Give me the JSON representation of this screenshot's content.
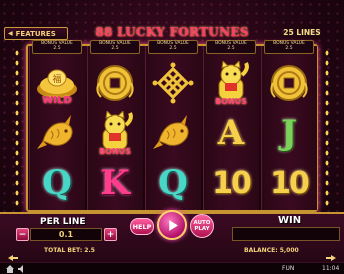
{
  "header": {
    "features_label": "FEATURES",
    "title": "88 LUCKY FORTUNES",
    "lines_label": "25 LINES"
  },
  "reels": [
    {
      "head": [
        "BONUS VALUE",
        "2.5"
      ],
      "symbols": [
        {
          "icon": "gold-ingot-icon",
          "tag": "WILD"
        },
        {
          "icon": "golden-koi-fish-icon",
          "tag": ""
        },
        {
          "icon": "letter-q-icon",
          "glyph": "Q"
        }
      ]
    },
    {
      "head": [
        "BONUS VALUE",
        "2.5"
      ],
      "symbols": [
        {
          "icon": "gold-coin-knot-icon",
          "tag": ""
        },
        {
          "icon": "lucky-cat-icon",
          "tag": "BONUS"
        },
        {
          "icon": "letter-k-icon",
          "glyph": "K"
        }
      ]
    },
    {
      "head": [
        "BONUS VALUE",
        "2.5"
      ],
      "symbols": [
        {
          "icon": "endless-knot-icon",
          "tag": ""
        },
        {
          "icon": "golden-koi-fish-icon",
          "tag": ""
        },
        {
          "icon": "letter-q-icon",
          "glyph": "Q"
        }
      ]
    },
    {
      "head": [
        "BONUS VALUE",
        "2.5"
      ],
      "symbols": [
        {
          "icon": "lucky-cat-icon",
          "tag": "BONUS"
        },
        {
          "icon": "letter-a-icon",
          "glyph": "A"
        },
        {
          "icon": "number-ten-icon",
          "glyph": "10"
        }
      ]
    },
    {
      "head": [
        "BONUS VALUE",
        "2.5"
      ],
      "symbols": [
        {
          "icon": "gold-coin-knot-icon",
          "tag": ""
        },
        {
          "icon": "letter-j-icon",
          "glyph": "J"
        },
        {
          "icon": "number-ten-icon",
          "glyph": "10"
        }
      ]
    }
  ],
  "controls": {
    "per_line_label": "PER LINE",
    "per_line_value": "0.1",
    "total_bet": "TOTAL BET: 2.5",
    "minus": "−",
    "plus": "+",
    "help_label": "HELP",
    "auto_label": "AUTO PLAY",
    "win_label": "WIN",
    "balance": "BALANCE: 5,000"
  },
  "status": {
    "mode": "FUN",
    "clock": "11:04"
  },
  "colors": {
    "accent_gold": "#f3d37a",
    "accent_pink": "#ff3b7a",
    "frame_gold": "#c69531"
  }
}
